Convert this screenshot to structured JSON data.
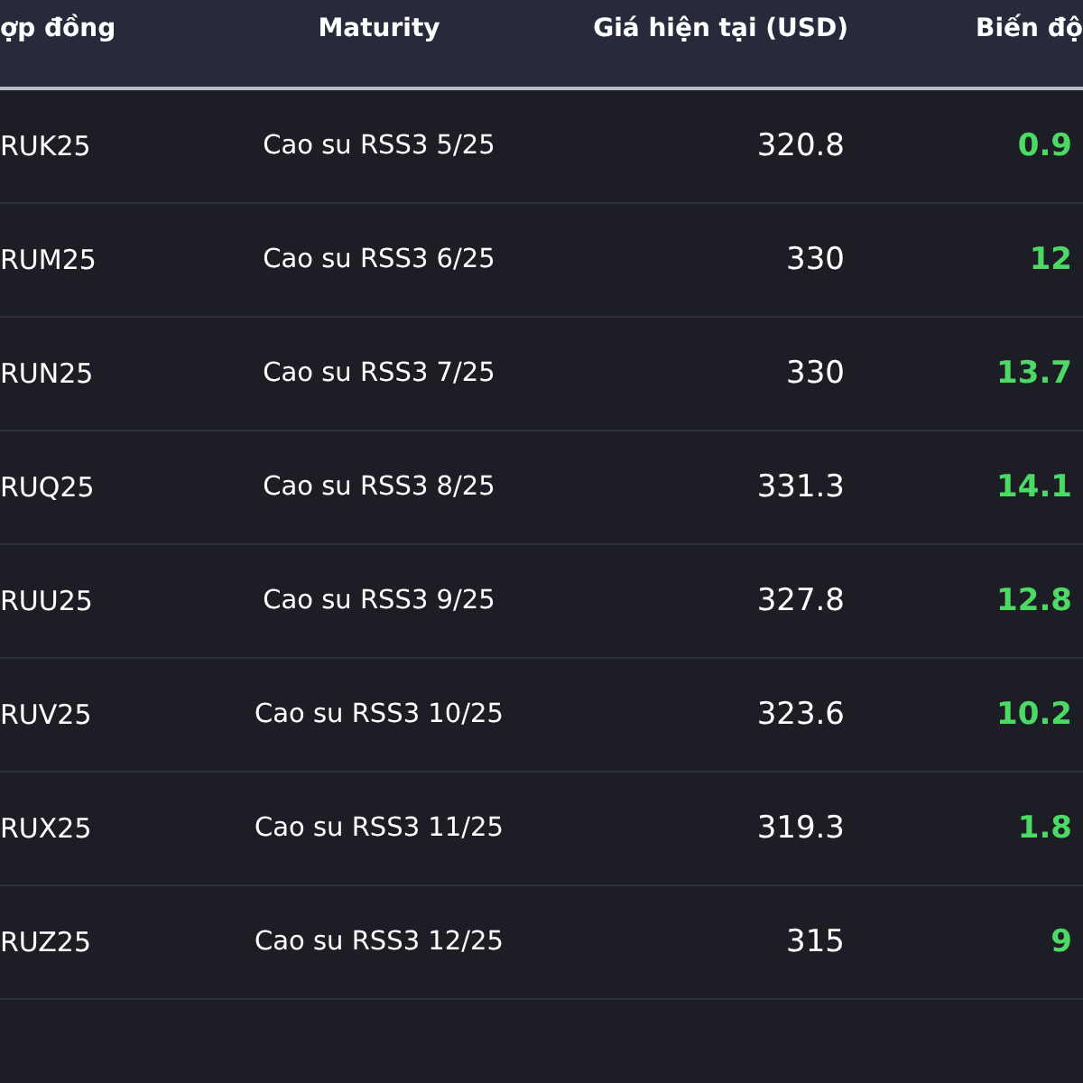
{
  "table": {
    "columns": [
      "ợp đồng",
      "Maturity",
      "Giá hiện tại (USD)",
      "Biến độ"
    ],
    "rows": [
      {
        "contract": "RUK25",
        "maturity": "Cao su RSS3 5/25",
        "price": "320.8",
        "change": "0.9"
      },
      {
        "contract": "RUM25",
        "maturity": "Cao su RSS3 6/25",
        "price": "330",
        "change": "12"
      },
      {
        "contract": "RUN25",
        "maturity": "Cao su RSS3 7/25",
        "price": "330",
        "change": "13.7"
      },
      {
        "contract": "RUQ25",
        "maturity": "Cao su RSS3 8/25",
        "price": "331.3",
        "change": "14.1"
      },
      {
        "contract": "RUU25",
        "maturity": "Cao su RSS3 9/25",
        "price": "327.8",
        "change": "12.8"
      },
      {
        "contract": "RUV25",
        "maturity": "Cao su RSS3 10/25",
        "price": "323.6",
        "change": "10.2"
      },
      {
        "contract": "RUX25",
        "maturity": "Cao su RSS3 11/25",
        "price": "319.3",
        "change": "1.8"
      },
      {
        "contract": "RUZ25",
        "maturity": "Cao su RSS3 12/25",
        "price": "315",
        "change": "9"
      }
    ]
  }
}
